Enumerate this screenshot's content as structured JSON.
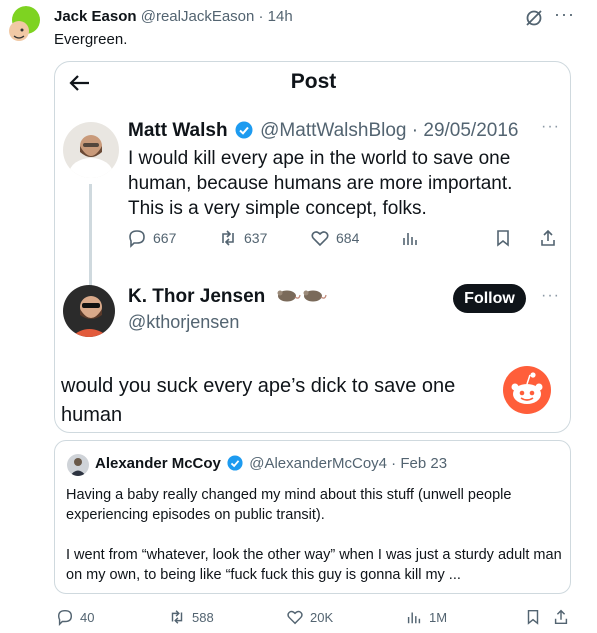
{
  "post": {
    "author_name": "Jack Eason",
    "author_meta": "@realJackEason · 14h",
    "text": "Evergreen.",
    "more_label": "···",
    "stats": {
      "replies": "40",
      "reposts": "588",
      "likes": "20K",
      "views": "1M"
    }
  },
  "screenshot": {
    "title": "Post",
    "original": {
      "author_name": "Matt Walsh",
      "author_meta": "@MattWalshBlog · 29/05/2016",
      "more_label": "···",
      "text": "I would kill every ape in the world to save one human, because humans are more important. This is a very simple concept, folks.",
      "stats": {
        "replies": "667",
        "reposts": "637",
        "likes": "684"
      }
    },
    "reply": {
      "author_name": "K. Thor Jensen",
      "author_handle": "@kthorjensen",
      "follow_label": "Follow",
      "more_label": "···",
      "text": "would you suck every ape’s dick to save one human"
    }
  },
  "quote": {
    "author_name": "Alexander McCoy",
    "author_meta": "@AlexanderMcCoy4 · Feb 23",
    "paragraph1": "Having a baby really changed my mind about this stuff (unwell people experiencing episodes on public transit).",
    "paragraph2": "I went from “whatever, look the other way” when I was just a sturdy adult man on my own, to being like “fuck fuck this guy is gonna kill my ..."
  },
  "colors": {
    "verified": "#1d9bf0",
    "muted": "#536471",
    "border": "#cfd9de",
    "avatar_green": "#7ed321",
    "reddit_orange": "#ff5e3a"
  },
  "icons": [
    "grok-icon",
    "back-arrow-icon",
    "verified-icon",
    "reply-icon",
    "repost-icon",
    "like-icon",
    "views-icon",
    "bookmark-icon",
    "share-icon",
    "rat-icon",
    "reddit-icon"
  ]
}
